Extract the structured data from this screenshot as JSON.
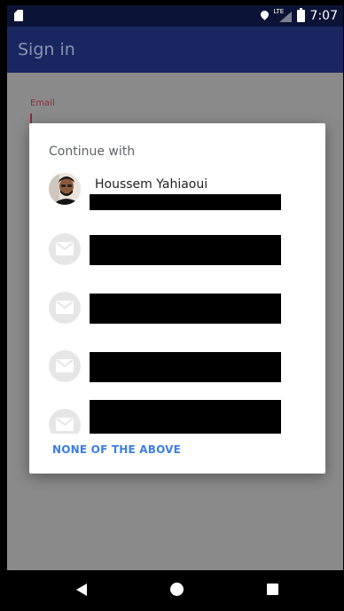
{
  "status_bar": {
    "time": "7:07",
    "network": "LTE",
    "icons": [
      "sd-card-icon",
      "location-icon",
      "lte-signal-icon",
      "battery-icon"
    ]
  },
  "app_bar": {
    "title": "Sign in"
  },
  "form": {
    "email_label": "Email"
  },
  "dialog": {
    "title": "Continue with",
    "accounts": [
      {
        "name": "Houssem Yahiaoui",
        "avatar": "profile-photo"
      },
      {
        "name": "",
        "avatar": "mail-icon"
      },
      {
        "name": "",
        "avatar": "mail-icon"
      },
      {
        "name": "",
        "avatar": "mail-icon"
      },
      {
        "name": "",
        "avatar": "mail-icon"
      }
    ],
    "none_button": "NONE OF THE ABOVE"
  },
  "colors": {
    "status_bar": "#0b1436",
    "app_bar": "#1a2660",
    "scrim_content": "#8a8a8a",
    "accent_link": "#3b7de8",
    "email_label": "#8a2b3e"
  },
  "nav_bar": {
    "icons": [
      "back-icon",
      "home-icon",
      "recents-icon"
    ]
  }
}
